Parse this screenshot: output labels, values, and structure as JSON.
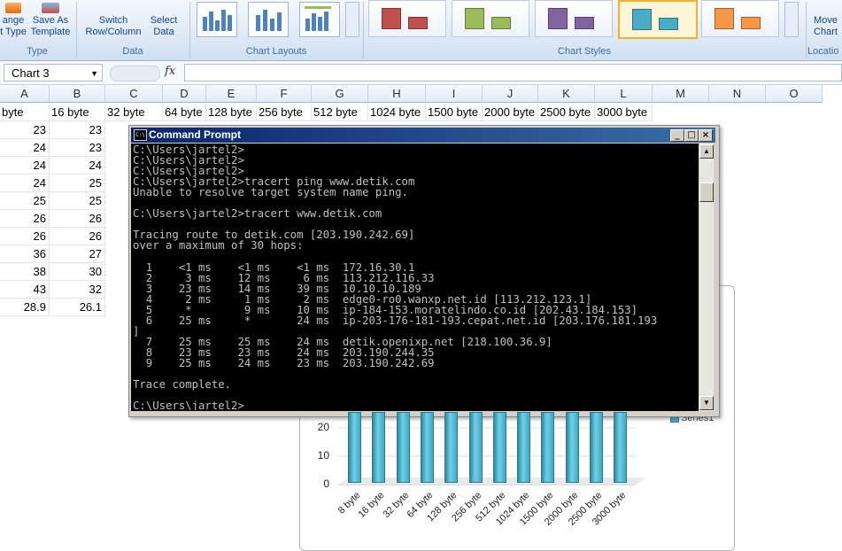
{
  "ribbon": {
    "groups": {
      "type": "Type",
      "data": "Data",
      "chart_layouts": "Chart Layouts",
      "chart_styles": "Chart Styles",
      "location": "Locatio"
    },
    "buttons": {
      "change_type_l1": "ange",
      "change_type_l2": "t Type",
      "save_template_l1": "Save As",
      "save_template_l2": "Template",
      "switch_l1": "Switch",
      "switch_l2": "Row/Column",
      "select_l1": "Select",
      "select_l2": "Data",
      "move_l1": "Move",
      "move_l2": "Chart"
    },
    "style_colors": [
      "#c0504d",
      "#9bbb59",
      "#8064a2",
      "#4bacc6",
      "#f79646"
    ],
    "selected_style": 3
  },
  "formula_bar": {
    "name_box": "Chart 3",
    "fx": "fx",
    "formula": ""
  },
  "sheet": {
    "columns": [
      "A",
      "B",
      "C",
      "D",
      "E",
      "F",
      "G",
      "H",
      "I",
      "J",
      "K",
      "L",
      "M",
      "N",
      "O"
    ],
    "header_row": [
      "byte",
      "16 byte",
      "32 byte",
      "64 byte",
      "128 byte",
      "256 byte",
      "512 byte",
      "1024 byte",
      "1500 byte",
      "2000 byte",
      "2500 byte",
      "3000 byte"
    ],
    "col_a": [
      "23",
      "24",
      "24",
      "24",
      "25",
      "26",
      "26",
      "36",
      "38",
      "43",
      "28.9"
    ],
    "col_b": [
      "23",
      "23",
      "24",
      "25",
      "25",
      "26",
      "26",
      "27",
      "30",
      "32",
      "26.1"
    ]
  },
  "cmd": {
    "title": "Command Prompt",
    "icon_text": "C:\\",
    "lines": [
      "C:\\Users\\jartel2>",
      "C:\\Users\\jartel2>",
      "C:\\Users\\jartel2>",
      "C:\\Users\\jartel2>tracert ping www.detik.com",
      "Unable to resolve target system name ping.",
      "",
      "C:\\Users\\jartel2>tracert www.detik.com",
      "",
      "Tracing route to detik.com [203.190.242.69]",
      "over a maximum of 30 hops:",
      "",
      "  1    <1 ms    <1 ms    <1 ms  172.16.30.1",
      "  2     3 ms    12 ms     6 ms  113.212.116.33",
      "  3    23 ms    14 ms    39 ms  10.10.10.189",
      "  4     2 ms     1 ms     2 ms  edge0-ro0.wanxp.net.id [113.212.123.1]",
      "  5     *        9 ms    10 ms  ip-184-153.moratelindo.co.id [202.43.184.153]",
      "  6    25 ms     *       24 ms  ip-203-176-181-193.cepat.net.id [203.176.181.193",
      "]",
      "  7    25 ms    25 ms    24 ms  detik.openixp.net [218.100.36.9]",
      "  8    23 ms    23 ms    24 ms  203.190.244.35",
      "  9    25 ms    24 ms    23 ms  203.190.242.69",
      "",
      "Trace complete.",
      "",
      "C:\\Users\\jartel2>"
    ]
  },
  "chart": {
    "legend": "Series1",
    "y_ticks": [
      "0",
      "10",
      "20"
    ],
    "categories": [
      "8 byte",
      "16 byte",
      "32 byte",
      "64 byte",
      "128 byte",
      "256 byte",
      "512 byte",
      "1024 byte",
      "1500 byte",
      "2000 byte",
      "2500 byte",
      "3000 byte"
    ],
    "bar_color": "#4bacc6"
  }
}
